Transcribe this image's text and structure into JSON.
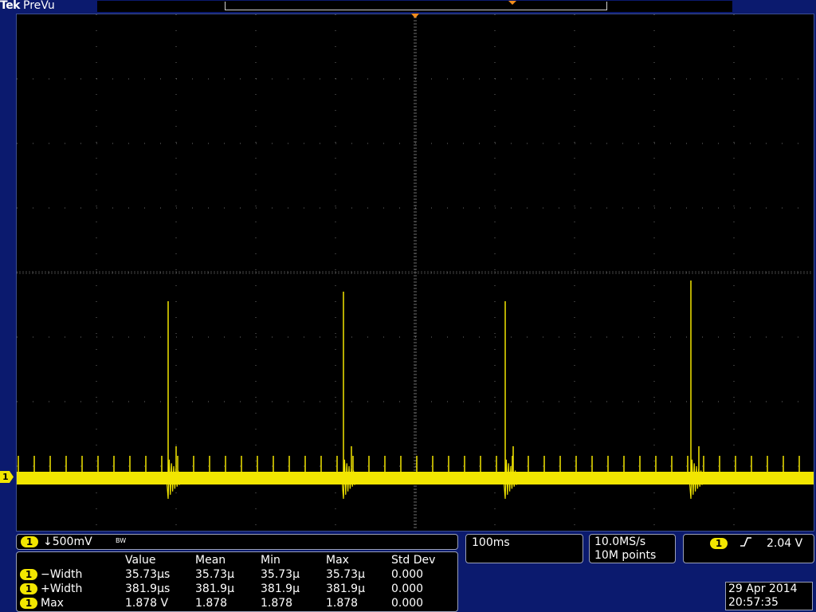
{
  "header": {
    "brand": "Tek",
    "mode": "PreVu"
  },
  "channel": {
    "number": "1",
    "scale": "↓500mV",
    "bw_limit_icon": "BW",
    "trace_color": "#f2e600"
  },
  "measurements": {
    "columns": [
      "Value",
      "Mean",
      "Min",
      "Max",
      "Std Dev"
    ],
    "rows": [
      {
        "channel": "1",
        "name": "−Width",
        "value": "35.73μs",
        "mean": "35.73μ",
        "min": "35.73μ",
        "max": "35.73μ",
        "std_dev": "0.000"
      },
      {
        "channel": "1",
        "name": "+Width",
        "value": "381.9μs",
        "mean": "381.9μ",
        "min": "381.9μ",
        "max": "381.9μ",
        "std_dev": "0.000"
      },
      {
        "channel": "1",
        "name": "Max",
        "value": "1.878 V",
        "mean": "1.878",
        "min": "1.878",
        "max": "1.878",
        "std_dev": "0.000"
      }
    ]
  },
  "horizontal": {
    "timebase": "100ms"
  },
  "acquisition": {
    "sample_rate": "10.0MS/s",
    "record_length": "10M points"
  },
  "trigger": {
    "channel": "1",
    "slope_icon": "rising-edge-icon",
    "level": "2.04 V"
  },
  "datetime": {
    "date": "29 Apr 2014",
    "time": "20:57:35"
  },
  "colors": {
    "background": "#0b1a6e",
    "screen": "#000000",
    "grid": "#6e6e6e",
    "marker": "#f28c1c"
  }
}
